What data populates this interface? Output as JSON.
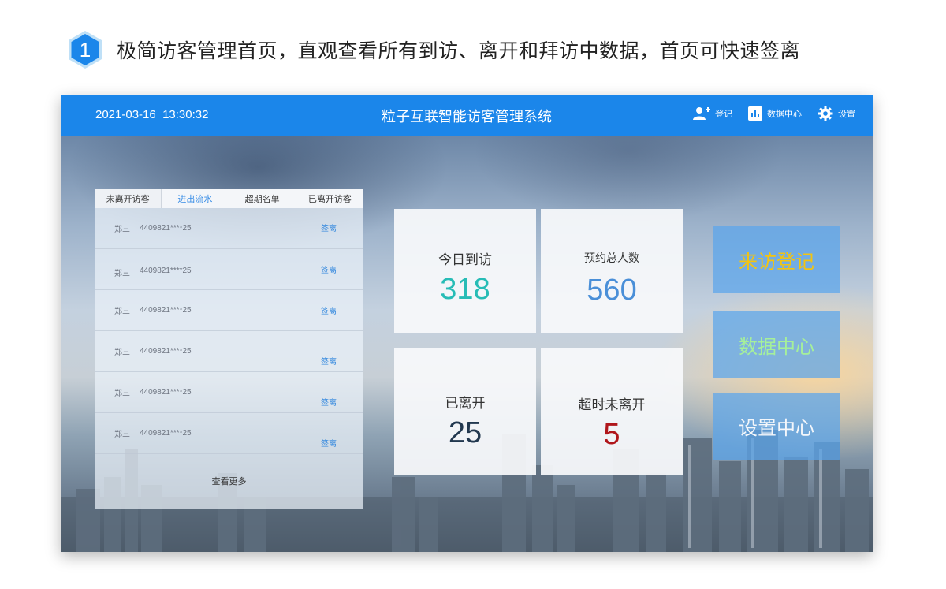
{
  "caption": {
    "step": "1",
    "text": "极简访客管理首页，直观查看所有到访、离开和拜访中数据，首页可快速签离"
  },
  "header": {
    "datetime": "2021-03-16  13:30:32",
    "title": "粒子互联智能访客管理系统",
    "actions": [
      {
        "label": "登记",
        "icon": "add-user-icon"
      },
      {
        "label": "数据中心",
        "icon": "bar-chart-icon"
      },
      {
        "label": "设置",
        "icon": "gear-icon"
      }
    ]
  },
  "tabs": [
    "未离开访客",
    "进出流水",
    "超期名单",
    "已离开访客"
  ],
  "visitors": [
    {
      "name": "郑三",
      "id": "4409821****25",
      "action": "签离"
    },
    {
      "name": "郑三",
      "id": "4409821****25",
      "action": "签离"
    },
    {
      "name": "郑三",
      "id": "4409821****25",
      "action": "签离"
    },
    {
      "name": "郑三",
      "id": "4409821****25",
      "action": "签离"
    },
    {
      "name": "郑三",
      "id": "4409821****25",
      "action": "签离"
    },
    {
      "name": "郑三",
      "id": "4409821****25",
      "action": "签离"
    }
  ],
  "view_more": "查看更多",
  "stats": {
    "today_visits": {
      "label": "今日到访",
      "value": "318",
      "color": "#27bcb6"
    },
    "reservations": {
      "label": "预约总人数",
      "value": "560",
      "color": "#4a8fd8"
    },
    "departed": {
      "label": "已离开",
      "value": "25",
      "color": "#22384f"
    },
    "overtime": {
      "label": "超时未离开",
      "value": "5",
      "color": "#b0161b"
    }
  },
  "buttons": {
    "visitor_register": {
      "label": "来访登记",
      "color": "#f3c410"
    },
    "data_center": {
      "label": "数据中心",
      "color": "#a6f09a"
    },
    "settings_center": {
      "label": "设置中心",
      "color": "#f4f7fb"
    }
  },
  "colors": {
    "topbar": "#1b86ea",
    "badge": "#1b86ea",
    "link": "#2f86de"
  }
}
